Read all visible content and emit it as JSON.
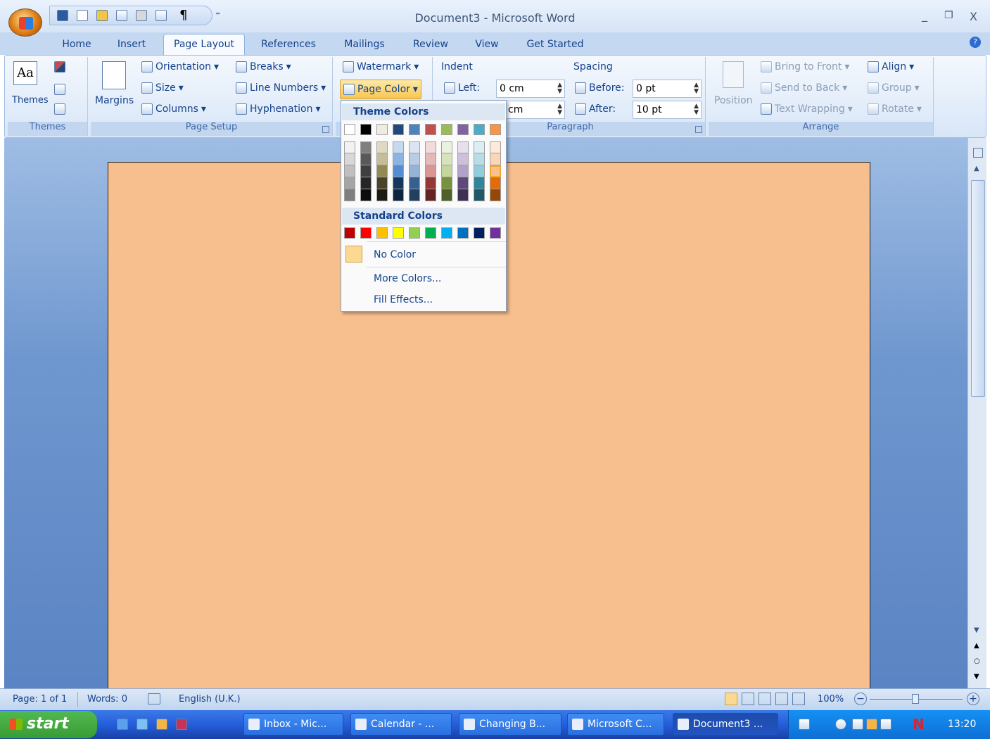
{
  "window": {
    "title": "Document3 - Microsoft Word",
    "min": "_",
    "restore": "❐",
    "close": "X"
  },
  "qat": {
    "overflow": "⁼"
  },
  "tabs": [
    {
      "label": "Home"
    },
    {
      "label": "Insert"
    },
    {
      "label": "Page Layout"
    },
    {
      "label": "References"
    },
    {
      "label": "Mailings"
    },
    {
      "label": "Review"
    },
    {
      "label": "View"
    },
    {
      "label": "Get Started"
    }
  ],
  "active_tab": "Page Layout",
  "themes_group": {
    "label": "Themes",
    "button": "Themes"
  },
  "page_setup": {
    "label": "Page Setup",
    "margins": "Margins",
    "orientation": "Orientation",
    "size": "Size",
    "columns": "Columns",
    "breaks": "Breaks",
    "line_numbers": "Line Numbers",
    "hyphenation": "Hyphenation"
  },
  "page_background": {
    "watermark": "Watermark",
    "page_color": "Page Color"
  },
  "paragraph": {
    "label": "Paragraph",
    "indent": "Indent",
    "left_label": "Left:",
    "left_value": "0 cm",
    "right_value": "cm",
    "spacing": "Spacing",
    "before_label": "Before:",
    "before_value": "0 pt",
    "after_label": "After:",
    "after_value": "10 pt"
  },
  "arrange": {
    "label": "Arrange",
    "position": "Position",
    "bring_to_front": "Bring to Front",
    "send_to_back": "Send to Back",
    "text_wrapping": "Text Wrapping",
    "align": "Align",
    "group": "Group",
    "rotate": "Rotate"
  },
  "page_color_menu": {
    "theme_colors_header": "Theme Colors",
    "theme_colors": [
      "#ffffff",
      "#000000",
      "#eeece1",
      "#1f497d",
      "#4f81bd",
      "#c0504d",
      "#9bbb59",
      "#8064a2",
      "#4bacc6",
      "#f79646"
    ],
    "theme_shades": [
      [
        "#f2f2f2",
        "#d8d8d8",
        "#bfbfbf",
        "#a5a5a5",
        "#7f7f7f"
      ],
      [
        "#7f7f7f",
        "#595959",
        "#3f3f3f",
        "#262626",
        "#0c0c0c"
      ],
      [
        "#ddd9c3",
        "#c4bd97",
        "#938953",
        "#494429",
        "#1d1b10"
      ],
      [
        "#c6d9f0",
        "#8db3e2",
        "#548dd4",
        "#17365d",
        "#0f243e"
      ],
      [
        "#dbe5f1",
        "#b8cce4",
        "#95b3d7",
        "#366092",
        "#244061"
      ],
      [
        "#f2dcdb",
        "#e5b9b7",
        "#d99694",
        "#953734",
        "#632423"
      ],
      [
        "#ebf1dd",
        "#d7e3bc",
        "#c3d69b",
        "#76923c",
        "#4f6128"
      ],
      [
        "#e5e0ec",
        "#ccc1d9",
        "#b2a2c7",
        "#5f497a",
        "#3f3151"
      ],
      [
        "#dbeef3",
        "#b7dde8",
        "#92cddc",
        "#31859b",
        "#205867"
      ],
      [
        "#fdeada",
        "#fbd5b5",
        "#fac08f",
        "#e36c09",
        "#974806"
      ]
    ],
    "standard_colors_header": "Standard Colors",
    "standard_colors": [
      "#c00000",
      "#ff0000",
      "#ffc000",
      "#ffff00",
      "#92d050",
      "#00b050",
      "#00b0f0",
      "#0070c0",
      "#002060",
      "#7030a0"
    ],
    "no_color": "No Color",
    "more_colors": "More Colors...",
    "fill_effects": "Fill Effects..."
  },
  "document": {
    "page_color": "#f7bf8e"
  },
  "status": {
    "page": "Page: 1 of 1",
    "words": "Words: 0",
    "language": "English (U.K.)",
    "zoom": "100%"
  },
  "taskbar": {
    "start": "start",
    "tasks": [
      {
        "label": "Inbox - Mic..."
      },
      {
        "label": "Calendar - ..."
      },
      {
        "label": "Changing B..."
      },
      {
        "label": "Microsoft C..."
      },
      {
        "label": "Document3 ..."
      }
    ],
    "time": "13:20"
  }
}
